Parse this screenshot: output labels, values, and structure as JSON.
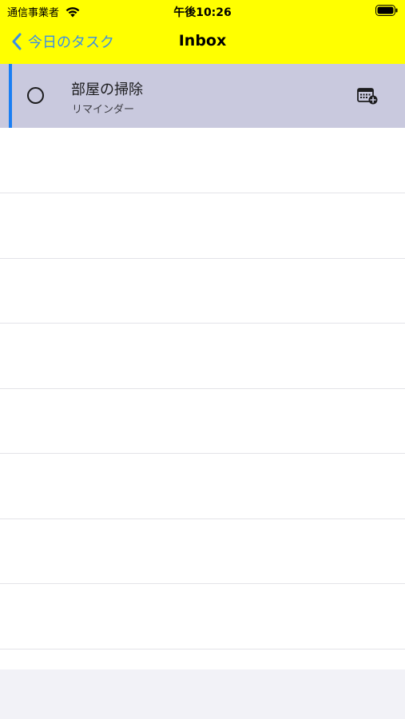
{
  "status_bar": {
    "carrier": "通信事業者",
    "time": "午後10:26"
  },
  "nav": {
    "back_label": "今日のタスク",
    "title": "Inbox"
  },
  "tasks": [
    {
      "title": "部屋の掃除",
      "subtitle": "リマインダー",
      "completed": false
    }
  ],
  "colors": {
    "header_bg": "#ffff00",
    "accent": "#1a7ef3",
    "selected_row": "#c9c9de",
    "link": "#3a8ee6"
  },
  "icons": {
    "back": "chevron-left-icon",
    "check": "circle-checkbox-icon",
    "calendar": "calendar-add-icon",
    "wifi": "wifi-icon",
    "battery": "battery-icon"
  }
}
